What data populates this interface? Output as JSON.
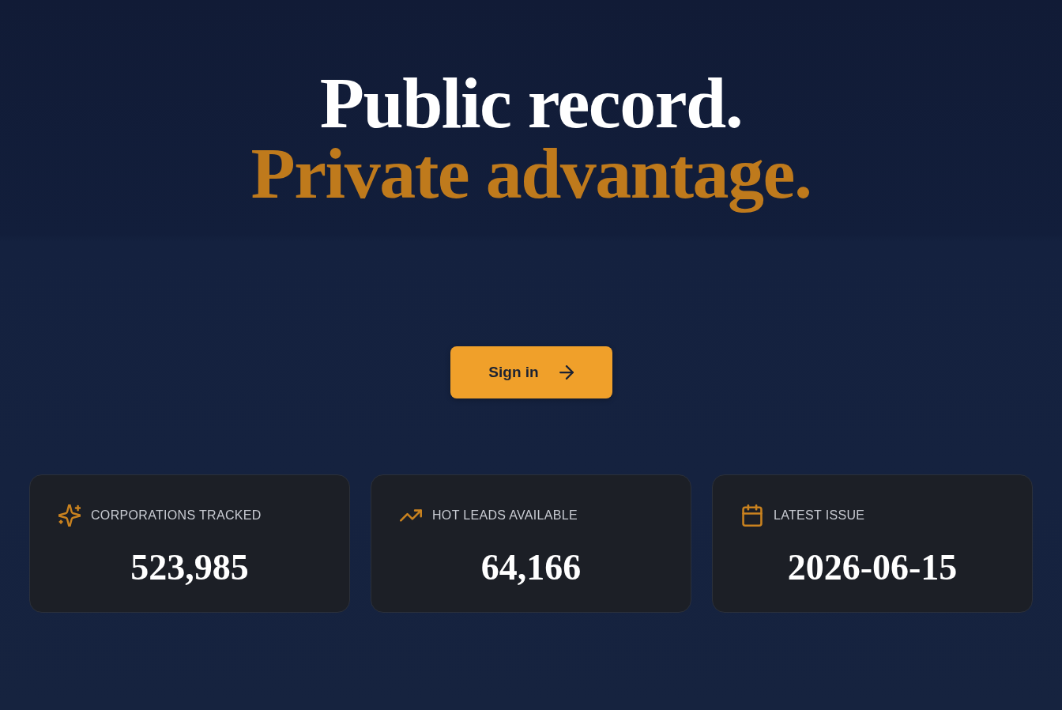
{
  "hero": {
    "headline": [
      {
        "text": "Public record.",
        "kind": "plain"
      },
      {
        "text": "Private advantage.",
        "kind": "accent"
      }
    ]
  },
  "sign_in_button": {
    "label": "Sign in"
  },
  "stats": [
    {
      "kind": "corporations",
      "label": "CORPORATIONS TRACKED",
      "value": "523,985"
    },
    {
      "kind": "leads",
      "label": "HOT LEADS AVAILABLE",
      "value": "64,166"
    },
    {
      "kind": "issue",
      "label": "LATEST ISSUE",
      "value": "2026-06-15"
    }
  ]
}
